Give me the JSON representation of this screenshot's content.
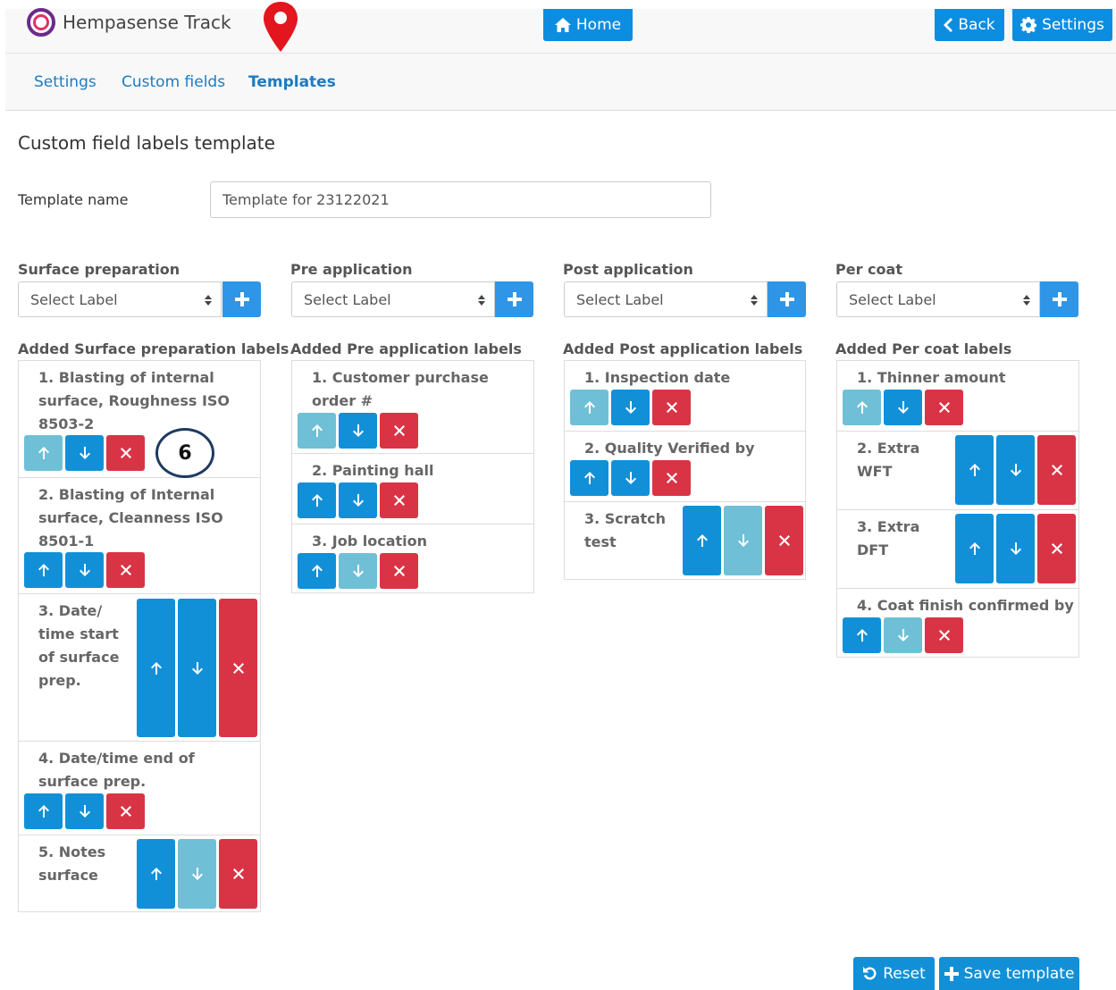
{
  "header": {
    "app_name": "Hempasense Track",
    "home_label": "Home",
    "back_label": "Back",
    "settings_label": "Settings"
  },
  "subnav": {
    "settings": "Settings",
    "custom_fields": "Custom fields",
    "templates": "Templates"
  },
  "page": {
    "title": "Custom field labels template",
    "template_name_label": "Template name",
    "template_name_value": "Template for 23122021"
  },
  "columns": [
    {
      "title": "Surface preparation",
      "select_value": "Select Label",
      "added_title": "Added Surface preparation labels",
      "items": [
        {
          "label": "1. Blasting of internal surface, Roughness ISO 8503-2"
        },
        {
          "label": "2. Blasting of Internal surface, Cleanness ISO 8501-1"
        },
        {
          "label": "3. Date/ time start of surface prep."
        },
        {
          "label": "4. Date/time end of surface prep."
        },
        {
          "label": "5. Notes surface"
        }
      ]
    },
    {
      "title": "Pre application",
      "select_value": "Select Label",
      "added_title": "Added Pre application labels",
      "items": [
        {
          "label": "1. Customer purchase order #"
        },
        {
          "label": "2. Painting hall"
        },
        {
          "label": "3. Job location"
        }
      ]
    },
    {
      "title": "Post application",
      "select_value": "Select Label",
      "added_title": "Added Post application labels",
      "items": [
        {
          "label": "1. Inspection date"
        },
        {
          "label": "2. Quality Verified by"
        },
        {
          "label": "3. Scratch test"
        }
      ]
    },
    {
      "title": "Per coat",
      "select_value": "Select Label",
      "added_title": "Added Per coat labels",
      "items": [
        {
          "label": "1. Thinner amount"
        },
        {
          "label": "2. Extra WFT"
        },
        {
          "label": "3. Extra DFT"
        },
        {
          "label": "4. Coat finish confirmed by"
        }
      ]
    }
  ],
  "callout": {
    "number": "6"
  },
  "footer": {
    "reset_label": "Reset",
    "save_label": "Save template"
  },
  "colors": {
    "primary": "#1190d8",
    "disabled": "#6fc0d6",
    "danger": "#d93445",
    "link": "#1d7bc1",
    "marker": "#e3151f"
  },
  "icons": [
    "home-icon",
    "chevron-left-icon",
    "gear-icon",
    "location-pin-icon",
    "plus-icon",
    "arrow-up-icon",
    "arrow-down-icon",
    "close-icon",
    "undo-icon"
  ]
}
